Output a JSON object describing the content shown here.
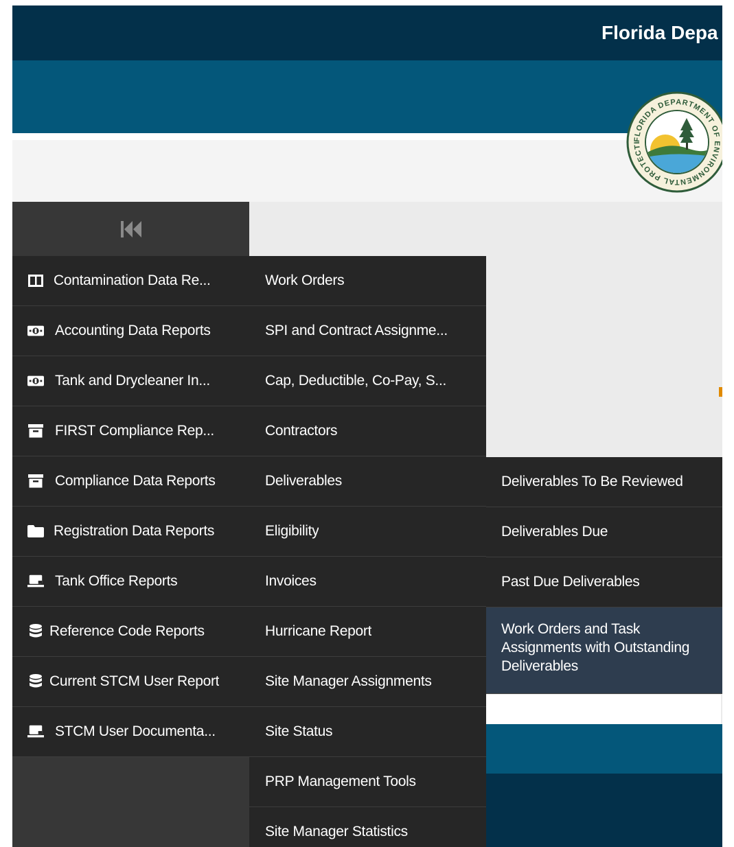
{
  "header": {
    "title": "Florida Depa"
  },
  "seal": {
    "icon": "fdep-seal-icon",
    "text": "FLORIDA DEPARTMENT OF ENVIRONMENTAL PROTECTION"
  },
  "sidebar": {
    "collapse_icon": "double-chevron-left-icon",
    "items": [
      {
        "label": "Contamination Data Re...",
        "icon": "columns-icon"
      },
      {
        "label": "Accounting Data Reports",
        "icon": "money-icon"
      },
      {
        "label": "Tank and Drycleaner In...",
        "icon": "money-icon"
      },
      {
        "label": "FIRST Compliance Rep...",
        "icon": "archive-icon"
      },
      {
        "label": "Compliance Data Reports",
        "icon": "archive-icon"
      },
      {
        "label": "Registration Data Reports",
        "icon": "folder-icon"
      },
      {
        "label": "Tank Office Reports",
        "icon": "laptop-icon"
      },
      {
        "label": "Reference Code Reports",
        "icon": "database-icon"
      },
      {
        "label": "Current STCM User Report",
        "icon": "database-icon"
      },
      {
        "label": "STCM User Documenta...",
        "icon": "laptop-icon"
      }
    ]
  },
  "submenu": {
    "items": [
      {
        "label": "Work Orders"
      },
      {
        "label": "SPI and Contract Assignme..."
      },
      {
        "label": "Cap, Deductible, Co-Pay, S..."
      },
      {
        "label": "Contractors"
      },
      {
        "label": "Deliverables"
      },
      {
        "label": "Eligibility"
      },
      {
        "label": "Invoices"
      },
      {
        "label": "Hurricane Report"
      },
      {
        "label": "Site Manager Assignments"
      },
      {
        "label": "Site Status"
      },
      {
        "label": "PRP Management Tools"
      },
      {
        "label": "Site Manager Statistics"
      }
    ]
  },
  "deliverables_menu": {
    "items": [
      {
        "label": "Deliverables To Be Reviewed"
      },
      {
        "label": "Deliverables Due"
      },
      {
        "label": "Past Due Deliverables"
      },
      {
        "label": "Work Orders and Task Assignments with Outstanding Deliverables"
      }
    ]
  },
  "colors": {
    "header_dark": "#03304a",
    "header_blue": "#04577a",
    "menu_bg": "#262626",
    "menu_active_bg": "#2e3d4f",
    "sidebar_empty_bg": "#373737",
    "text": "#ffffff"
  }
}
